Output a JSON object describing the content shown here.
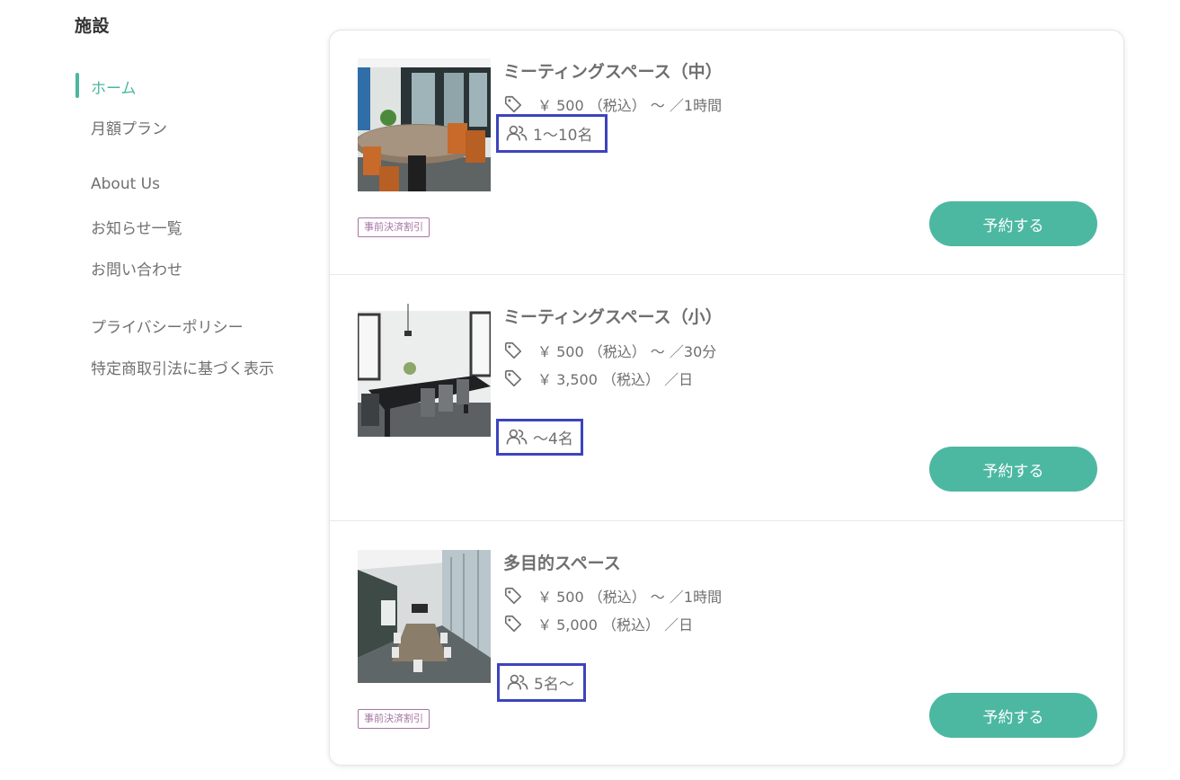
{
  "section_title": "施設",
  "nav": [
    {
      "label": "ホーム",
      "active": true
    },
    {
      "label": "月額プラン",
      "active": false
    },
    {
      "label": "About Us",
      "active": false
    },
    {
      "label": "お知らせ一覧",
      "active": false
    },
    {
      "label": "お問い合わせ",
      "active": false
    },
    {
      "label": "プライバシーポリシー",
      "active": false
    },
    {
      "label": "特定商取引法に基づく表示",
      "active": false
    }
  ],
  "facilities": [
    {
      "title": "ミーティングスペース（中）",
      "prices": [
        "￥ 500 （税込） ～ ／1時間"
      ],
      "capacity": "1～10名",
      "badge": "事前決済割引",
      "button": "予約する"
    },
    {
      "title": "ミーティングスペース（小）",
      "prices": [
        "￥ 500 （税込） ～ ／30分",
        "￥ 3,500 （税込） ／日"
      ],
      "capacity": "～4名",
      "badge": "",
      "button": "予約する"
    },
    {
      "title": "多目的スペース",
      "prices": [
        "￥ 500 （税込） ～ ／1時間",
        "￥ 5,000 （税込） ／日"
      ],
      "capacity": "5名～",
      "badge": "事前決済割引",
      "button": "予約する"
    }
  ],
  "colors": {
    "accent": "#4cb6a0",
    "button": "#4db8a2",
    "highlight_border": "#3c44bd",
    "badge": "#a874a4",
    "text": "#6f6f6f"
  }
}
